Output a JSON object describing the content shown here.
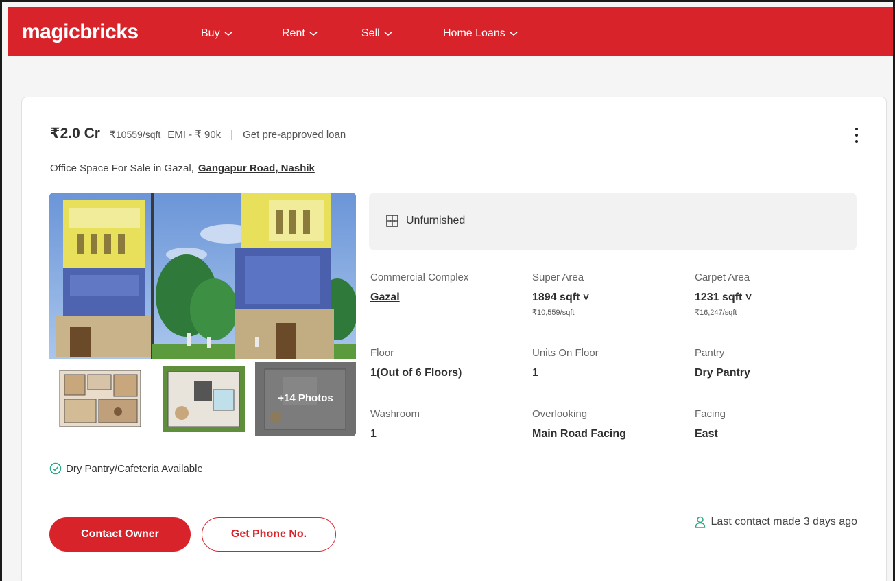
{
  "header": {
    "logo": "magicbricks",
    "nav": [
      {
        "label": "Buy"
      },
      {
        "label": "Rent"
      },
      {
        "label": "Sell"
      },
      {
        "label": "Home Loans"
      }
    ]
  },
  "listing": {
    "price": "₹2.0 Cr",
    "price_per_sqft": "₹10559/sqft",
    "emi": "EMI - ₹ 90k",
    "separator": "|",
    "loan_link": "Get pre-approved loan",
    "subtitle_prefix": "Office Space For Sale in Gazal,",
    "location": "Gangapur Road, Nashik",
    "photos_count": "+14 Photos",
    "furnishing": "Unfurnished",
    "specs": {
      "commercial_complex": {
        "label": "Commercial Complex",
        "value": "Gazal"
      },
      "super_area": {
        "label": "Super Area",
        "value": "1894 sqft",
        "sub": "₹10,559/sqft"
      },
      "carpet_area": {
        "label": "Carpet Area",
        "value": "1231 sqft",
        "sub": "₹16,247/sqft"
      },
      "floor": {
        "label": "Floor",
        "value": "1(Out of 6 Floors)"
      },
      "units_on_floor": {
        "label": "Units On Floor",
        "value": "1"
      },
      "pantry": {
        "label": "Pantry",
        "value": "Dry Pantry"
      },
      "washroom": {
        "label": "Washroom",
        "value": "1"
      },
      "overlooking": {
        "label": "Overlooking",
        "value": "Main Road Facing"
      },
      "facing": {
        "label": "Facing",
        "value": "East"
      }
    },
    "amenity": "Dry Pantry/Cafeteria Available",
    "contact_button": "Contact Owner",
    "phone_button": "Get Phone No.",
    "last_contact": "Last contact made 3 days ago"
  },
  "colors": {
    "brand": "#d8232a",
    "accent_green": "#2aa784"
  }
}
